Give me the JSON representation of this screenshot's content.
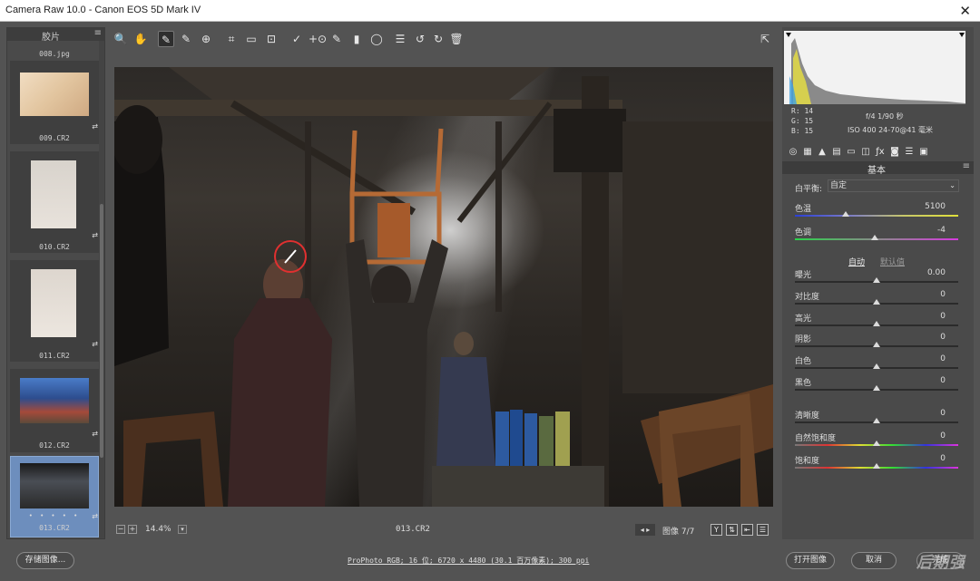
{
  "window": {
    "title": "Camera Raw 10.0 -  Canon EOS 5D Mark IV",
    "close": "✕"
  },
  "filmstrip": {
    "header": "胶片",
    "items": [
      {
        "name": "008.jpg"
      },
      {
        "name": "009.CR2"
      },
      {
        "name": "010.CR2"
      },
      {
        "name": "011.CR2"
      },
      {
        "name": "012.CR2"
      },
      {
        "name": "013.CR2"
      }
    ],
    "rating_dots": "• • • • •",
    "badge": "⇄"
  },
  "toolbar": {
    "icons": [
      "zoom-icon",
      "hand-icon",
      "white-balance-icon",
      "color-sampler-icon",
      "targeted-adjust-icon",
      "crop-icon",
      "straighten-icon",
      "transform-icon",
      "spot-removal-icon",
      "red-eye-icon",
      "adjustment-brush-icon",
      "graduated-filter-icon",
      "radial-filter-icon",
      "preferences-icon",
      "rotate-ccw-icon",
      "rotate-cw-icon",
      "trash-icon"
    ],
    "glyphs": [
      "🔍",
      "✋",
      "✎",
      "✎",
      "⊕",
      "⌗",
      "▭",
      "⊡",
      "✓",
      "+⊙",
      "✎",
      "▮",
      "◯",
      "☰",
      "↺",
      "↻",
      "🗑"
    ],
    "fullscreen": "⇱"
  },
  "canvas": {
    "zoom_minus": "−",
    "zoom_plus": "+",
    "zoom": "14.4%",
    "filename": "013.CR2",
    "image_count": "图像 7/7",
    "nav": "◂ ▸",
    "y_button": "Y"
  },
  "readout": {
    "r": "R:    14",
    "g": "G:    15",
    "b": "B:    15",
    "aperture_shutter": "f/4   1/90 秒",
    "iso_lens": "ISO 400   24-70@41 毫米"
  },
  "panel": {
    "section_title": "基本",
    "wb_label": "白平衡:",
    "wb_value": "自定",
    "auto": "自动",
    "default": "默认值",
    "sliders": [
      {
        "id": "temperature",
        "label": "色温",
        "value": "5100",
        "pos": 0.31
      },
      {
        "id": "tint",
        "label": "色调",
        "value": "-4",
        "pos": 0.49
      },
      {
        "id": "exposure",
        "label": "曝光",
        "value": "0.00",
        "pos": 0.5
      },
      {
        "id": "contrast",
        "label": "对比度",
        "value": "0",
        "pos": 0.5
      },
      {
        "id": "highlights",
        "label": "高光",
        "value": "0",
        "pos": 0.5
      },
      {
        "id": "shadows",
        "label": "阴影",
        "value": "0",
        "pos": 0.5
      },
      {
        "id": "whites",
        "label": "白色",
        "value": "0",
        "pos": 0.5
      },
      {
        "id": "blacks",
        "label": "黑色",
        "value": "0",
        "pos": 0.5
      },
      {
        "id": "clarity",
        "label": "清晰度",
        "value": "0",
        "pos": 0.5
      },
      {
        "id": "vibrance",
        "label": "自然饱和度",
        "value": "0",
        "pos": 0.5
      },
      {
        "id": "saturation",
        "label": "饱和度",
        "value": "0",
        "pos": 0.5
      }
    ]
  },
  "bottom": {
    "save": "存储图像...",
    "workflow": "ProPhoto RGB; 16 位; 6720 x 4480 (30.1 百万像素); 300 ppi",
    "open": "打开图像",
    "cancel": "取消",
    "done": "完成",
    "watermark": "后期强"
  }
}
